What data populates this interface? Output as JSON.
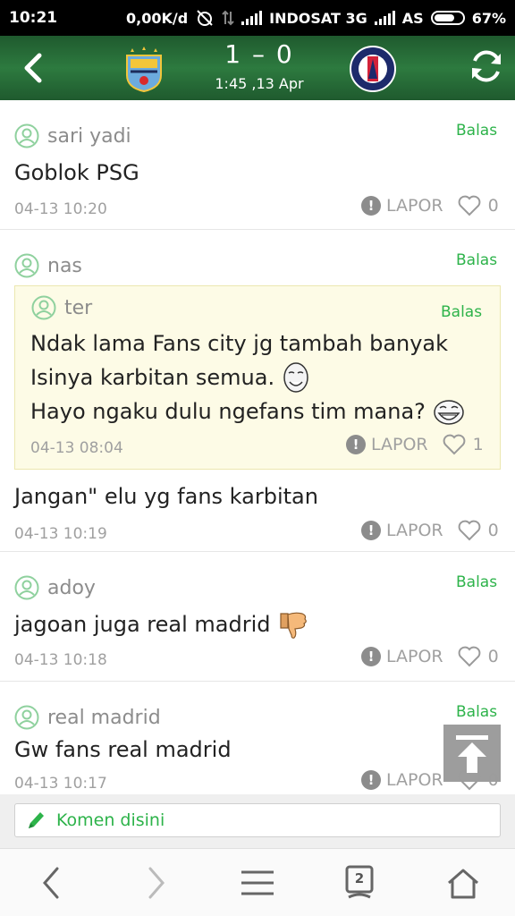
{
  "status": {
    "time": "10:21",
    "net_speed": "0,00K/d",
    "carrier1": "INDOSAT 3G",
    "carrier2": "AS",
    "battery": "67%"
  },
  "match": {
    "score_home": "1",
    "score_sep": "–",
    "score_away": "0",
    "time": "1:45 ,13 Apr"
  },
  "comments": [
    {
      "user": "sari yadi",
      "reply": "Balas",
      "text": "Goblok PSG",
      "time": "04-13 10:20",
      "report": "LAPOR",
      "likes": "0"
    },
    {
      "user": "nas",
      "reply": "Balas",
      "quote": {
        "user": "ter",
        "reply": "Balas",
        "lines": [
          "Ndak lama Fans city jg tambah banyak",
          "Isinya karbitan semua.",
          "Hayo ngaku dulu ngefans tim mana?"
        ],
        "time": "04-13 08:04",
        "report": "LAPOR",
        "likes": "1"
      },
      "text": "Jangan\" elu yg fans karbitan",
      "time": "04-13 10:19",
      "report": "LAPOR",
      "likes": "0"
    },
    {
      "user": "adoy",
      "reply": "Balas",
      "text": "jagoan juga real madrid",
      "time": "04-13 10:18",
      "report": "LAPOR",
      "likes": "0"
    },
    {
      "user": "real madrid",
      "reply": "Balas",
      "text": "Gw fans real madrid",
      "time": "04-13 10:17",
      "report": "LAPOR",
      "likes": "0"
    }
  ],
  "input": {
    "placeholder": "Komen disini"
  },
  "nav": {
    "tabs_count": "2"
  },
  "colors": {
    "accent": "#2db34a",
    "header": "#2d7a3f",
    "quote_bg": "#fdfbe6"
  }
}
